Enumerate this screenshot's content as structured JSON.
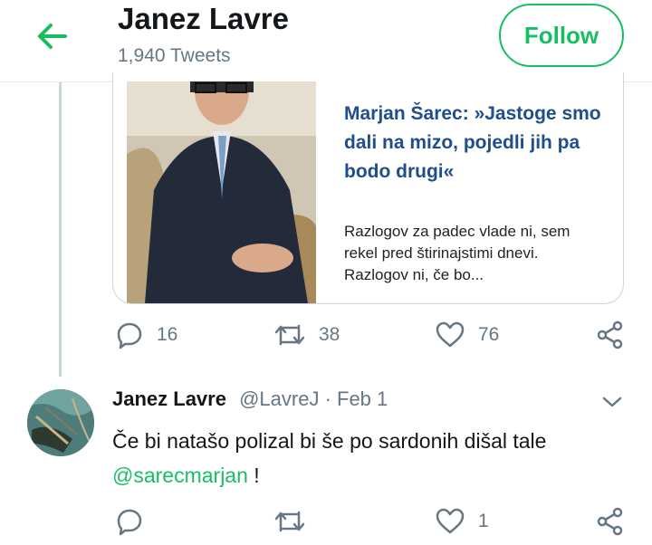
{
  "header": {
    "name": "Janez Lavre",
    "tweet_count": "1,940 Tweets",
    "follow_label": "Follow"
  },
  "card": {
    "title": "Marjan Šarec: »Jastoge smo dali na mizo, pojedli jih pa bodo drugi«",
    "description": "Razlogov za padec vlade ni, sem rekel pred štirinajstimi dnevi. Razlogov ni, če bo..."
  },
  "tweet1_actions": {
    "replies": "16",
    "retweets": "38",
    "likes": "76"
  },
  "tweet2": {
    "name": "Janez Lavre",
    "handle_date": "@LavreJ · Feb 1",
    "text_before": "Če bi natašo polizal bi še po sardonih dišal tale ",
    "mention": "@sarecmarjan",
    "text_after": " !",
    "actions": {
      "replies": "",
      "retweets": "",
      "likes": "1"
    }
  },
  "colors": {
    "accent": "#17bf63",
    "muted": "#657786",
    "card_title": "#1f4e8c"
  },
  "icons": [
    "back-arrow-icon",
    "reply-icon",
    "retweet-icon",
    "like-icon",
    "share-icon",
    "chevron-down-icon"
  ]
}
